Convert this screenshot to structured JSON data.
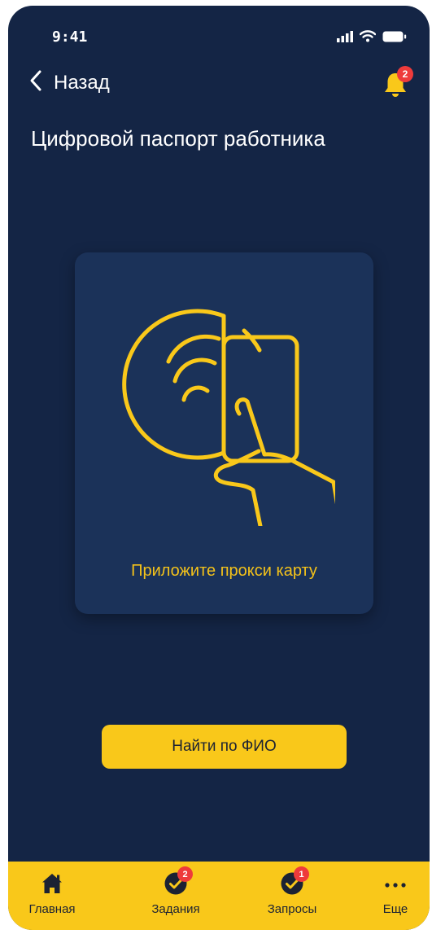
{
  "status_bar": {
    "time": "9:41",
    "icons": [
      "signal-icon",
      "wifi-icon",
      "battery-icon"
    ]
  },
  "header": {
    "back_label": "Назад",
    "notifications_badge": "2",
    "title": "Цифровой паспорт работника"
  },
  "card": {
    "illustration": "hand-holding-proxy-card",
    "caption": "Приложите прокси карту"
  },
  "actions": {
    "find_by_name_label": "Найти по ФИО"
  },
  "tab_bar": {
    "items": [
      {
        "label": "Главная",
        "icon": "home-icon",
        "badge": ""
      },
      {
        "label": "Задания",
        "icon": "check-circle-icon",
        "badge": "2"
      },
      {
        "label": "Запросы",
        "icon": "check-circle-icon",
        "badge": "1"
      },
      {
        "label": "Еще",
        "icon": "more-dots-icon",
        "badge": ""
      }
    ]
  },
  "colors": {
    "background": "#142545",
    "card": "#1b3259",
    "accent": "#f9c81a",
    "badge": "#ee3b3b",
    "text_light": "#ffffff",
    "text_dark": "#1c2233"
  }
}
